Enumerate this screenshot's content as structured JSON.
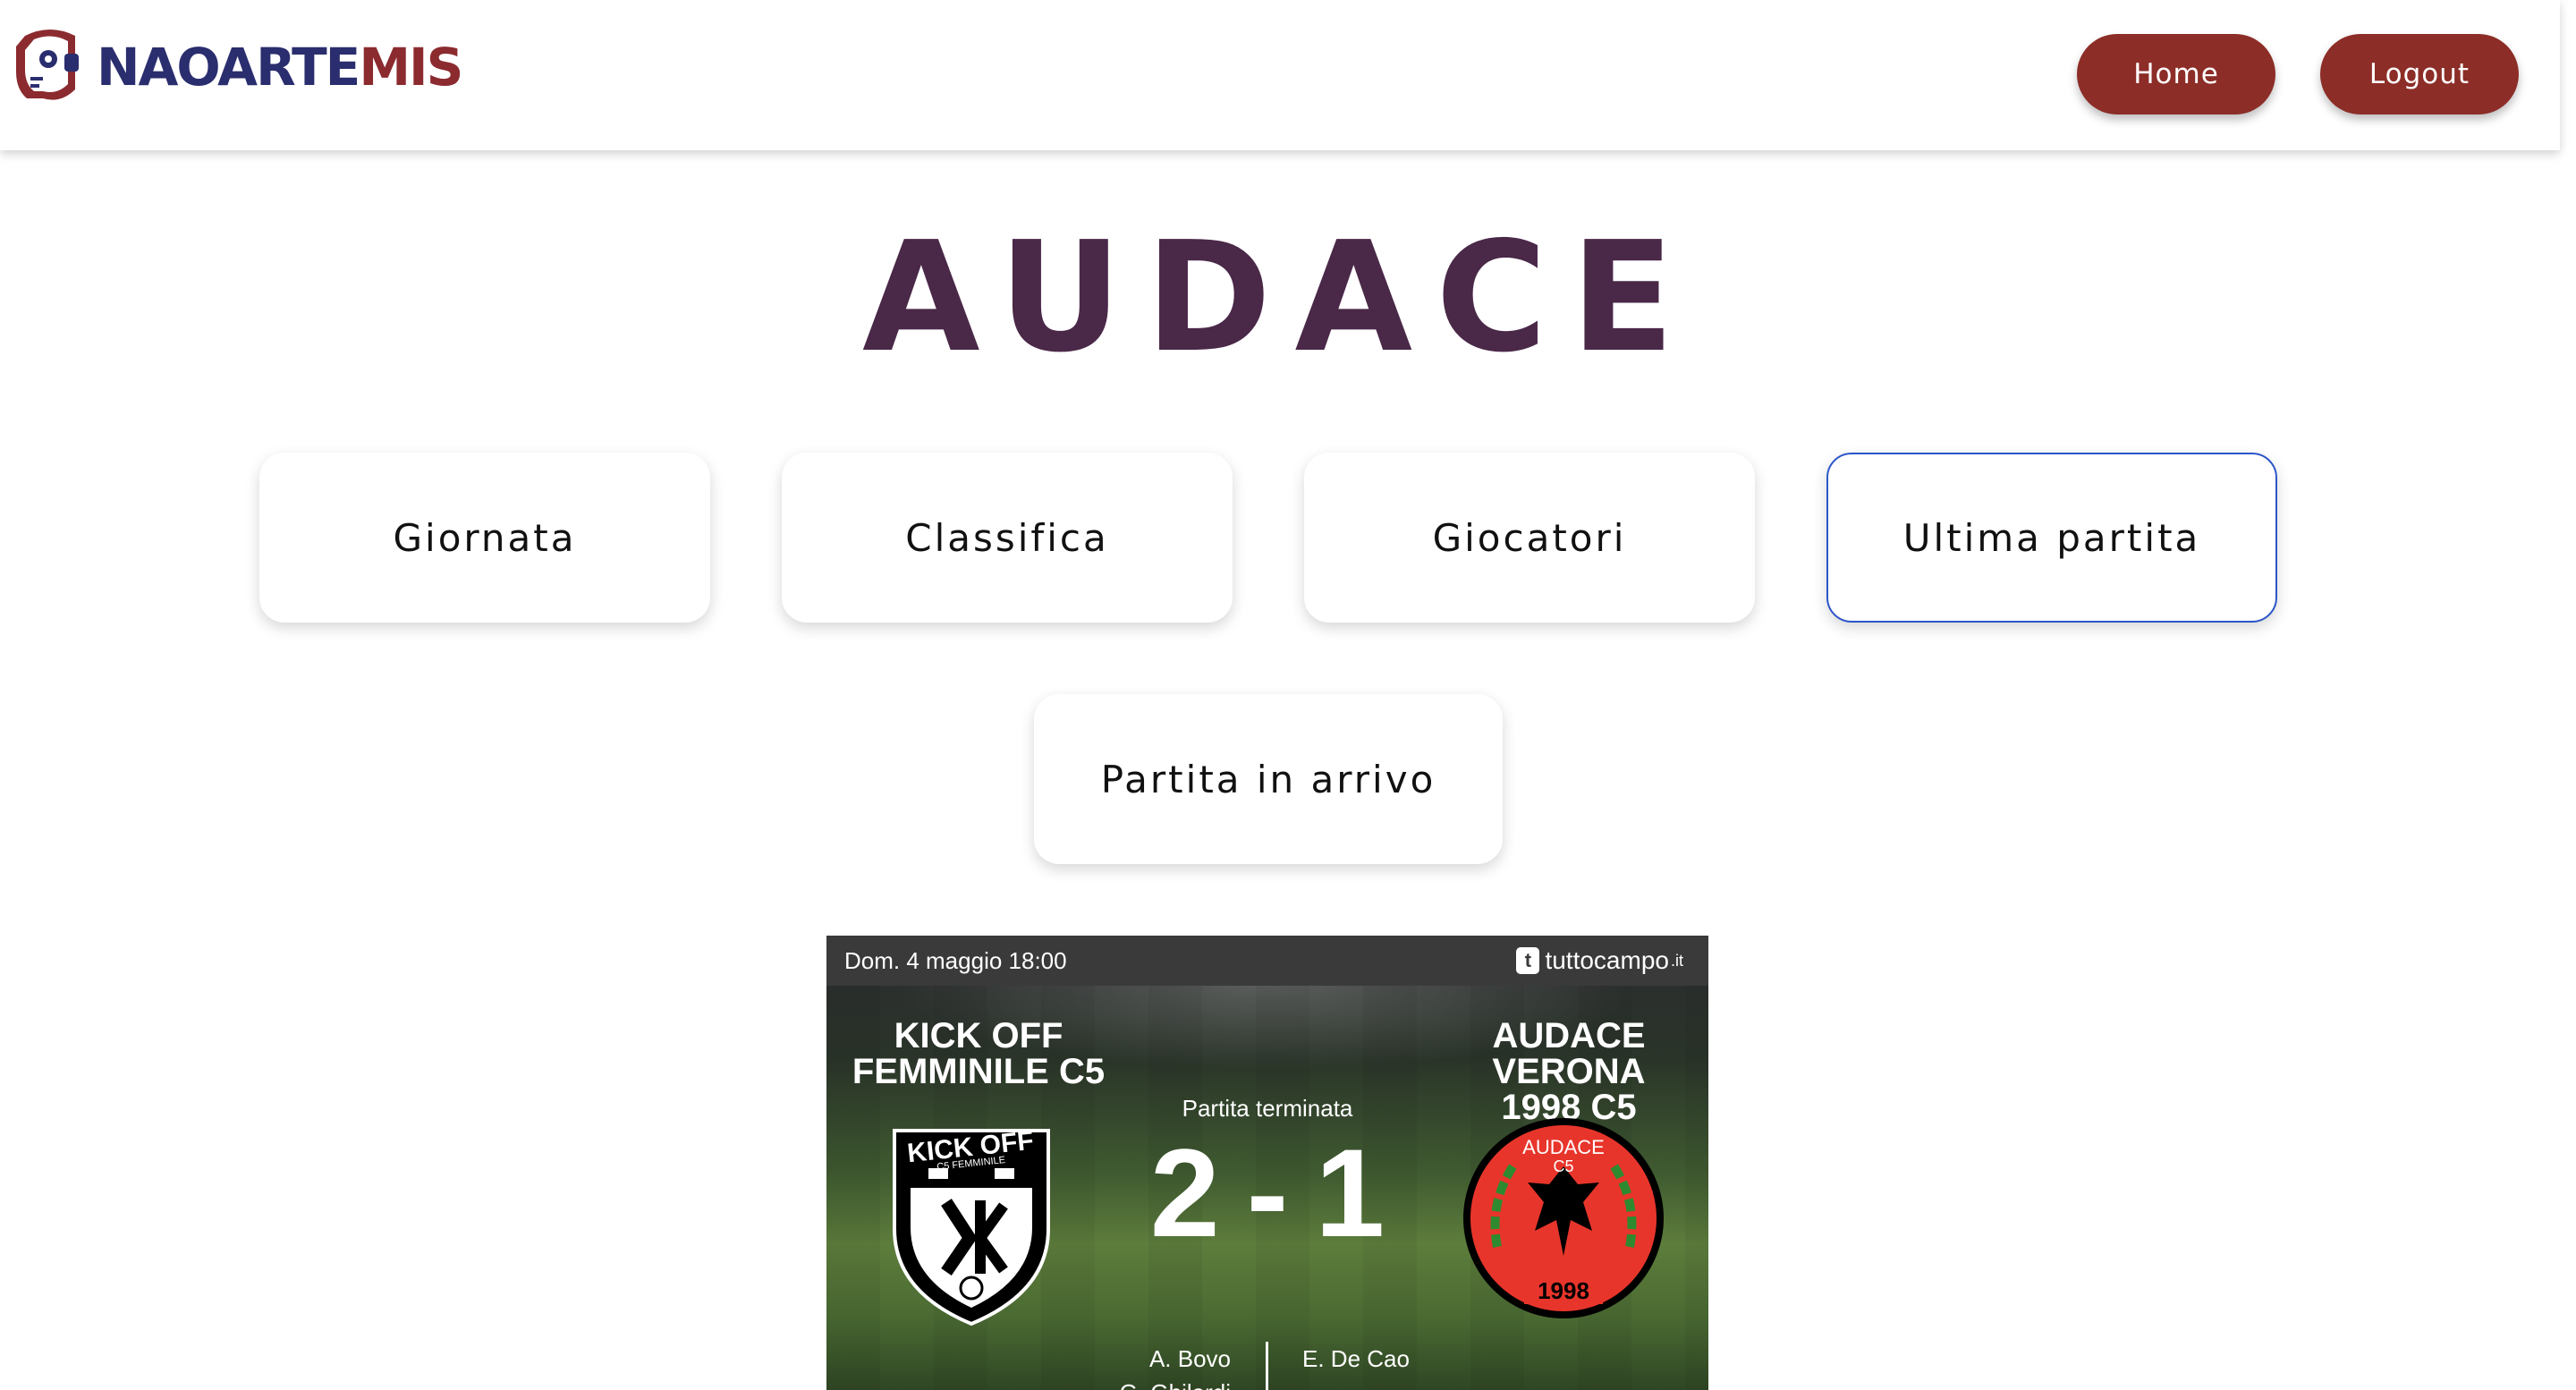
{
  "header": {
    "logo": {
      "name_part1": "NAOARTE",
      "name_part2": "MIS"
    },
    "nav": {
      "home_label": "Home",
      "logout_label": "Logout"
    }
  },
  "team_title": "AUDACE",
  "menu": {
    "items": [
      {
        "label": "Giornata",
        "active": false
      },
      {
        "label": "Classifica",
        "active": false
      },
      {
        "label": "Giocatori",
        "active": false
      },
      {
        "label": "Ultima partita",
        "active": true
      },
      {
        "label": "Partita in arrivo",
        "active": false
      }
    ]
  },
  "match_widget": {
    "date": "Dom. 4 maggio 18:00",
    "brand": {
      "icon": "t",
      "name": "tuttocampo",
      "tld": ".it"
    },
    "home_team": {
      "name_line1": "KICK OFF",
      "name_line2": "FEMMINILE C5",
      "crest_text1": "KICK OFF",
      "crest_text2": "C5 FEMMINILE"
    },
    "away_team": {
      "name_line1": "AUDACE VERONA",
      "name_line2": "1998 C5",
      "crest_text1": "AUDACE",
      "crest_text2": "C5",
      "crest_year": "1998"
    },
    "status": "Partita terminata",
    "score": {
      "home": "2",
      "separator": "-",
      "away": "1"
    },
    "scorers_home": [
      "A. Bovo",
      "G. Ghilardi"
    ],
    "scorers_away": [
      "E. De Cao"
    ]
  },
  "colors": {
    "brand_blue": "#2a2d6e",
    "brand_red": "#8b2b2f",
    "nav_button": "#8c2d27",
    "title": "#4a2848",
    "active_card_border": "#2b56c8",
    "widget_bar": "#3a3a3a",
    "away_crest_red": "#e8352b",
    "away_crest_green": "#2f8a2f"
  }
}
